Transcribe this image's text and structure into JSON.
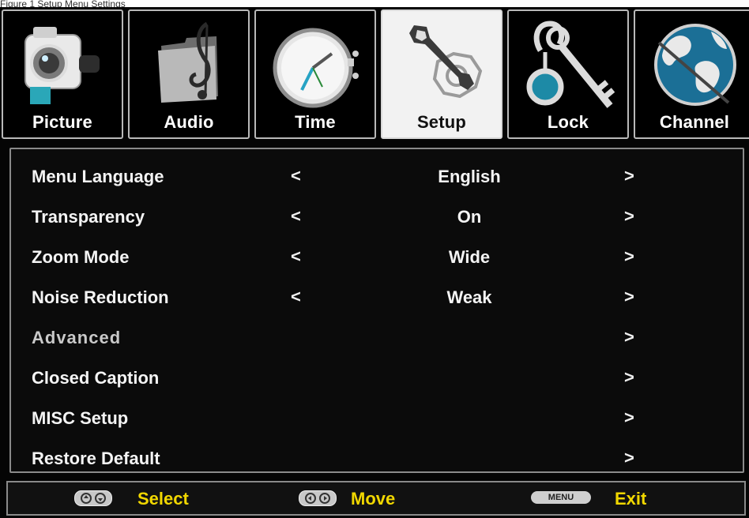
{
  "caption": "Figure 1 Setup Menu Settings",
  "tabs": [
    {
      "label": "Picture",
      "icon": "camera-icon",
      "active": false
    },
    {
      "label": "Audio",
      "icon": "music-folder-icon",
      "active": false
    },
    {
      "label": "Time",
      "icon": "clock-icon",
      "active": false
    },
    {
      "label": "Setup",
      "icon": "wrench-icon",
      "active": true
    },
    {
      "label": "Lock",
      "icon": "key-icon",
      "active": false
    },
    {
      "label": "Channel",
      "icon": "globe-icon",
      "active": false
    }
  ],
  "menu": {
    "rows": [
      {
        "label": "Menu Language",
        "value": "English",
        "left_arrow": "<",
        "right_arrow": ">"
      },
      {
        "label": "Transparency",
        "value": "On",
        "left_arrow": "<",
        "right_arrow": ">"
      },
      {
        "label": "Zoom Mode",
        "value": "Wide",
        "left_arrow": "<",
        "right_arrow": ">"
      },
      {
        "label": "Noise Reduction",
        "value": "Weak",
        "left_arrow": "<",
        "right_arrow": ">"
      },
      {
        "label": "Advanced",
        "value": "",
        "left_arrow": "",
        "right_arrow": ">",
        "dimmed": true
      },
      {
        "label": "Closed Caption",
        "value": "",
        "left_arrow": "",
        "right_arrow": ">"
      },
      {
        "label": "MISC Setup",
        "value": "",
        "left_arrow": "",
        "right_arrow": ">"
      },
      {
        "label": "Restore Default",
        "value": "",
        "left_arrow": "",
        "right_arrow": ">"
      }
    ]
  },
  "footer": {
    "select_label": "Select",
    "move_label": "Move",
    "menu_key": "MENU",
    "exit_label": "Exit"
  },
  "colors": {
    "footer_text": "#f1d700",
    "active_tab_bg": "#f2f2f2",
    "background": "#050505"
  }
}
